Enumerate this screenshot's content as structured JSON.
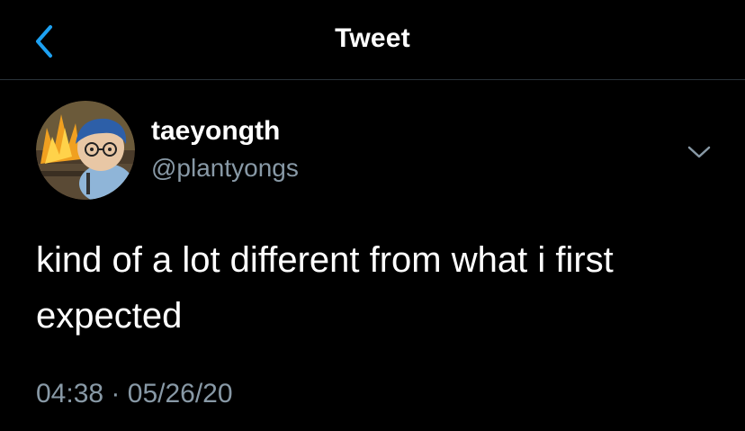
{
  "header": {
    "title": "Tweet",
    "back_icon": "chevron-left-icon"
  },
  "tweet": {
    "author_name": "taeyongth",
    "author_handle": "@plantyongs",
    "text": "kind of a lot different from what i first expected",
    "time": "04:38",
    "separator": "·",
    "date": "05/26/20",
    "menu_icon": "chevron-down-icon"
  },
  "colors": {
    "background": "#000000",
    "text_primary": "#ffffff",
    "text_secondary": "#8899a6",
    "accent": "#1da1f2",
    "divider": "#38444d"
  }
}
